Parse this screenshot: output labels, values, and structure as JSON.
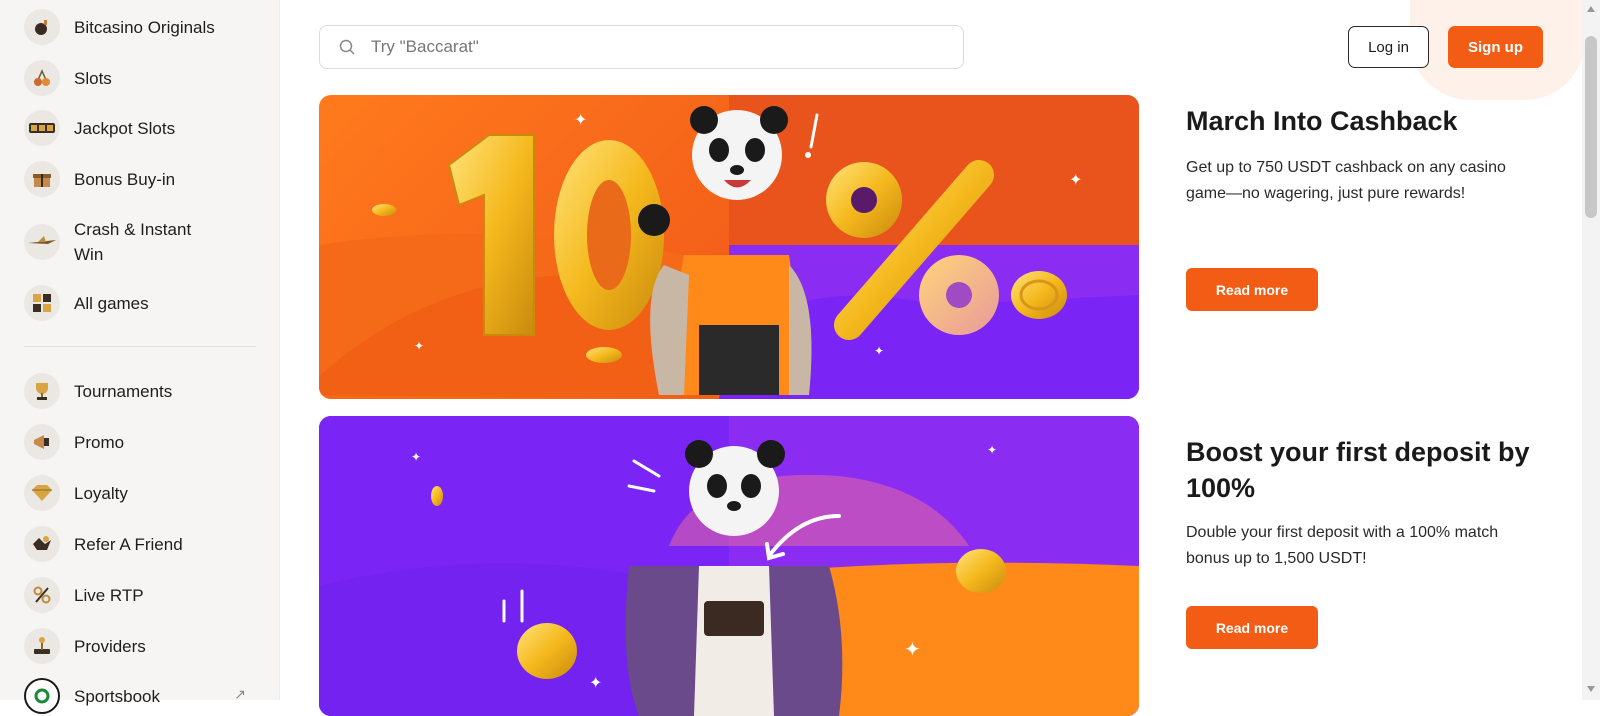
{
  "sidebar": {
    "items": [
      {
        "label": "Bitcasino Originals",
        "icon": "bomb-icon"
      },
      {
        "label": "Slots",
        "icon": "cherries-icon"
      },
      {
        "label": "Jackpot Slots",
        "icon": "slot-reels-icon"
      },
      {
        "label": "Bonus Buy-in",
        "icon": "gift-box-icon"
      },
      {
        "label": "Crash & Instant Win",
        "icon": "airplane-icon"
      },
      {
        "label": "All games",
        "icon": "grid-icon"
      }
    ],
    "items2": [
      {
        "label": "Tournaments",
        "icon": "trophy-icon"
      },
      {
        "label": "Promo",
        "icon": "megaphone-icon"
      },
      {
        "label": "Loyalty",
        "icon": "diamond-icon"
      },
      {
        "label": "Refer A Friend",
        "icon": "hand-shake-icon"
      },
      {
        "label": "Live RTP",
        "icon": "percent-icon"
      },
      {
        "label": "Providers",
        "icon": "joystick-icon"
      },
      {
        "label": "Sportsbook",
        "icon": "sportsbook-icon"
      }
    ]
  },
  "search": {
    "placeholder": "Try \"Baccarat\""
  },
  "header": {
    "login_label": "Log in",
    "signup_label": "Sign up"
  },
  "banners": [
    {
      "big_text": "10%"
    }
  ],
  "promos": [
    {
      "title": "March Into Cashback",
      "description": "Get up to 750 USDT cashback on any casino game—no wagering, just pure rewards!",
      "cta": "Read more"
    },
    {
      "title": "Boost your first deposit by 100%",
      "description": "Double your first deposit with a 100% match bonus up to 1,500 USDT!",
      "cta": "Read more"
    }
  ],
  "colors": {
    "accent": "#f25c14",
    "banner_orange": "#f4601a",
    "banner_purple": "#7a24f5"
  }
}
